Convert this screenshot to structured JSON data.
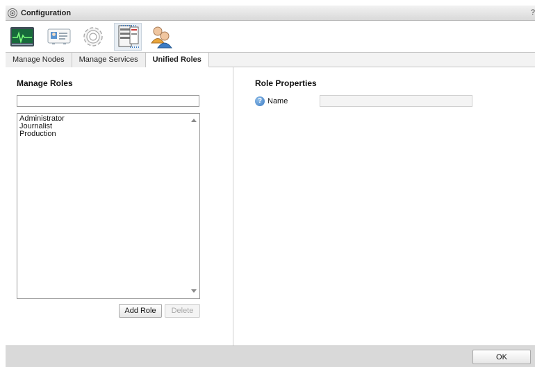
{
  "window": {
    "title": "Configuration",
    "help": "?"
  },
  "toolbar": {
    "tools": [
      {
        "icon": "monitor-icon"
      },
      {
        "icon": "id-card-icon"
      },
      {
        "icon": "gear-icon"
      },
      {
        "icon": "server-rack-icon",
        "selected": true
      },
      {
        "icon": "users-icon"
      }
    ]
  },
  "tabs": [
    {
      "label": "Manage Nodes"
    },
    {
      "label": "Manage Services"
    },
    {
      "label": "Unified Roles",
      "active": true
    }
  ],
  "manage_roles": {
    "title": "Manage Roles",
    "filter_value": "",
    "roles": [
      "Administrator",
      "Journalist",
      "Production"
    ],
    "add_button": "Add Role",
    "delete_button": "Delete"
  },
  "role_properties": {
    "title": "Role Properties",
    "name_label": "Name",
    "name_value": ""
  },
  "footer": {
    "ok_button": "OK"
  }
}
